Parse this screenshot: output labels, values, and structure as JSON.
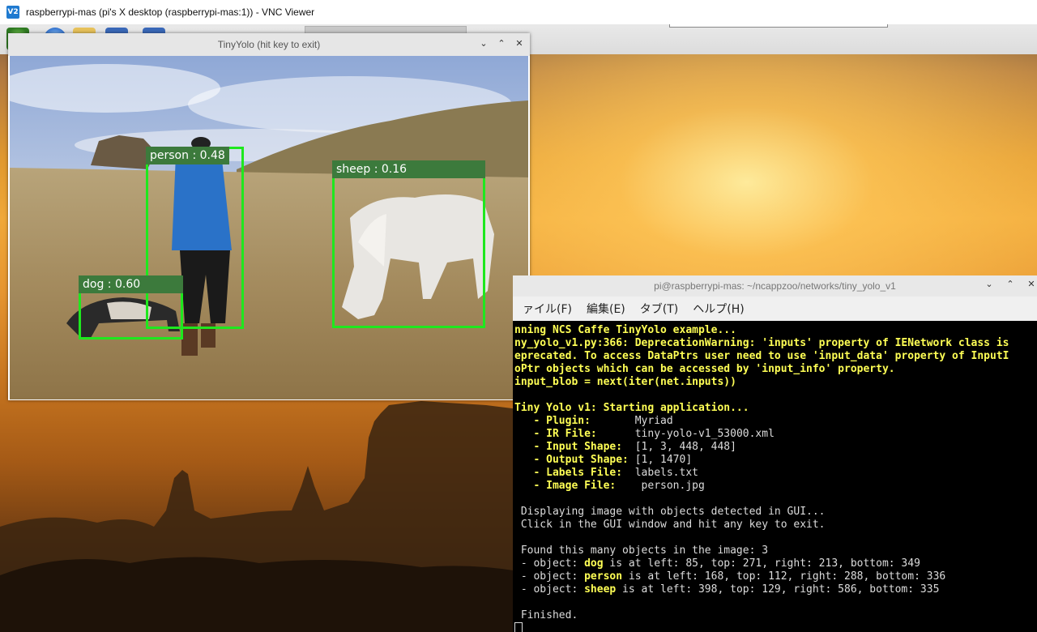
{
  "vnc": {
    "title": "raspberrypi-mas (pi's X desktop (raspberrypi-mas:1)) - VNC Viewer",
    "icon": "vnc-viewer-icon"
  },
  "yolo_window": {
    "title": "TinyYolo (hit key to exit)",
    "controls": {
      "minimize": "⌄",
      "maximize": "⌃",
      "close": "✕"
    },
    "detections": [
      {
        "label": "person : 0.48"
      },
      {
        "label": "sheep : 0.16"
      },
      {
        "label": "dog : 0.60"
      }
    ]
  },
  "terminal": {
    "title": "pi@raspberrypi-mas: ~/ncappzoo/networks/tiny_yolo_v1",
    "controls": {
      "minimize": "⌄",
      "maximize": "⌃",
      "close": "✕"
    },
    "menu": [
      "ァイル(F)",
      "編集(E)",
      "タブ(T)",
      "ヘルプ(H)"
    ],
    "warning_lines": [
      "nning NCS Caffe TinyYolo example...",
      "ny_yolo_v1.py:366: DeprecationWarning: 'inputs' property of IENetwork class is",
      "eprecated. To access DataPtrs user need to use 'input_data' property of InputI",
      "oPtr objects which can be accessed by 'input_info' property.",
      "input_blob = next(iter(net.inputs))"
    ],
    "header": "Tiny Yolo v1: Starting application...",
    "params": [
      {
        "key": "   - Plugin:       ",
        "value": "Myriad"
      },
      {
        "key": "   - IR File:      ",
        "value": "tiny-yolo-v1_53000.xml"
      },
      {
        "key": "   - Input Shape:  ",
        "value": "[1, 3, 448, 448]"
      },
      {
        "key": "   - Output Shape: ",
        "value": "[1, 1470]"
      },
      {
        "key": "   - Labels File:  ",
        "value": "labels.txt"
      },
      {
        "key": "   - Image File:   ",
        "value": " person.jpg"
      }
    ],
    "display_lines": [
      " Displaying image with objects detected in GUI...",
      " Click in the GUI window and hit any key to exit."
    ],
    "found": " Found this many objects in the image: 3",
    "objects": [
      {
        "prefix": " - object: ",
        "name": "dog",
        "rest": " is at left: 85, top: 271, right: 213, bottom: 349"
      },
      {
        "prefix": " - object: ",
        "name": "person",
        "rest": " is at left: 168, top: 112, right: 288, bottom: 336"
      },
      {
        "prefix": " - object: ",
        "name": "sheep",
        "rest": " is at left: 398, top: 129, right: 586, bottom: 335"
      }
    ],
    "finished": " Finished."
  }
}
